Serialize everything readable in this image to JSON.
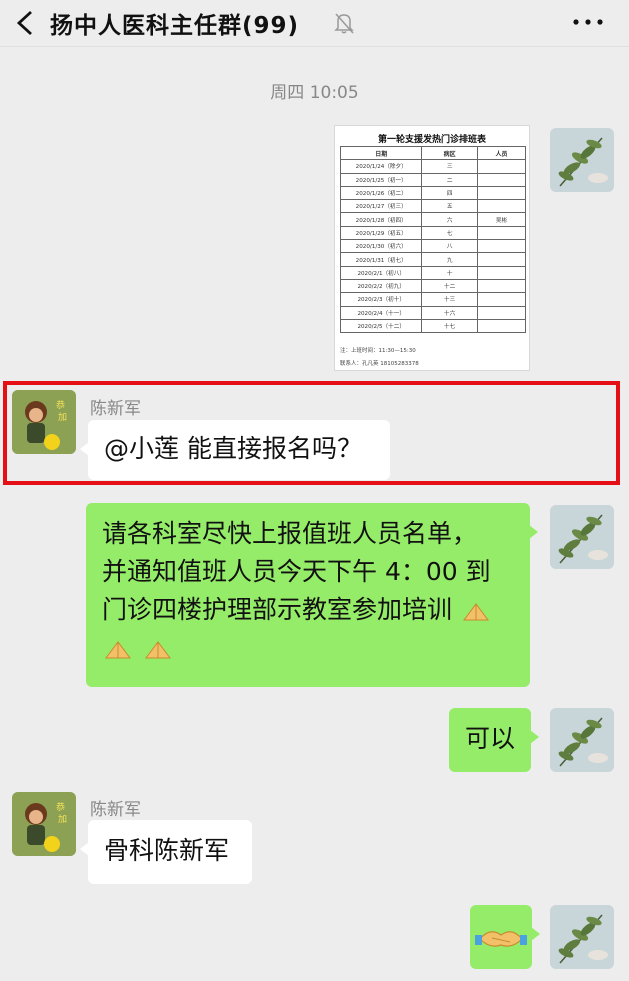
{
  "header": {
    "title": "扬中人医科主任群(99)"
  },
  "timestamp": "周四 10:05",
  "schedule_image": {
    "title": "第一轮支援发热门诊排班表",
    "columns": [
      "日期",
      "病区",
      "人员"
    ],
    "rows": [
      [
        "2020/1/24（除夕）",
        "三",
        ""
      ],
      [
        "2020/1/25（初一）",
        "二",
        ""
      ],
      [
        "2020/1/26（初二）",
        "四",
        ""
      ],
      [
        "2020/1/27（初三）",
        "五",
        ""
      ],
      [
        "2020/1/28（初四）",
        "六",
        "吴彬"
      ],
      [
        "2020/1/29（初五）",
        "七",
        ""
      ],
      [
        "2020/1/30（初六）",
        "八",
        ""
      ],
      [
        "2020/1/31（初七）",
        "九",
        ""
      ],
      [
        "2020/2/1（初八）",
        "十",
        ""
      ],
      [
        "2020/2/2（初九）",
        "十二",
        ""
      ],
      [
        "2020/2/3（初十）",
        "十三",
        ""
      ],
      [
        "2020/2/4（十一）",
        "十六",
        ""
      ],
      [
        "2020/2/5（十二）",
        "十七",
        ""
      ]
    ],
    "note1": "注：上班时间：11:30—15:30",
    "note2": "联系人：孔凡英  18105283378"
  },
  "messages": {
    "m1_sender": "陈新军",
    "m1_text": "@小莲  能直接报名吗？",
    "m2_line1": "请各科室尽快上报值班人员名单，",
    "m2_line2": "并通知值班人员今天下午 4：00 到",
    "m2_line3": "门诊四楼护理部示教室参加培训",
    "m3_text": "可以",
    "m4_sender": "陈新军",
    "m4_text": "骨科陈新军"
  },
  "colors": {
    "green_bubble": "#95ec69",
    "white_bubble": "#ffffff",
    "highlight_border": "#e50f16",
    "background": "#ededed"
  },
  "icons": [
    "back-icon",
    "mute-bell-icon",
    "more-icon",
    "clap-emoji-icon",
    "handshake-emoji-icon"
  ]
}
